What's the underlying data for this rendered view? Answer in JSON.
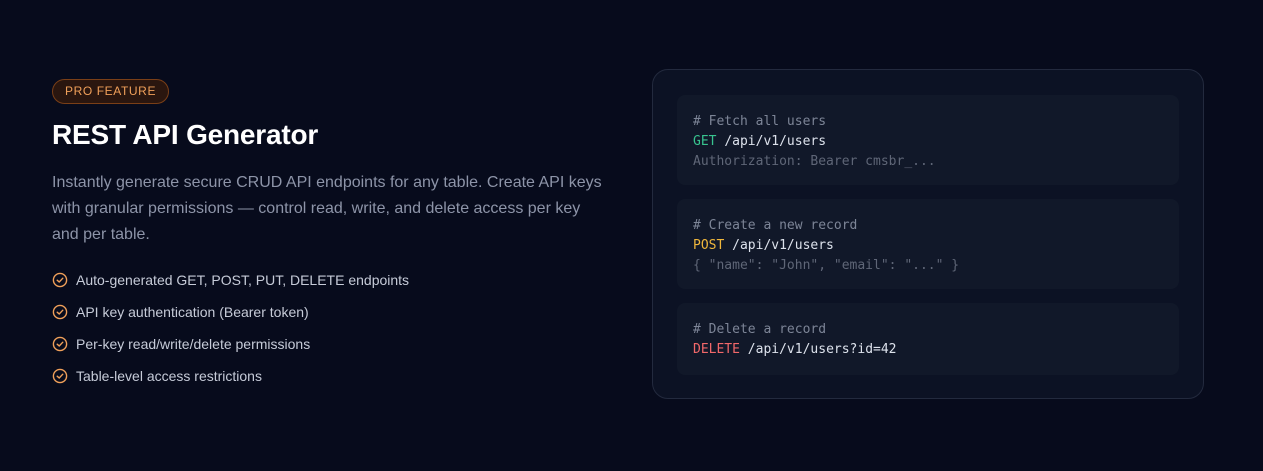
{
  "badge": "PRO FEATURE",
  "title": "REST API Generator",
  "description": "Instantly generate secure CRUD API endpoints for any table. Create API keys with granular permissions — control read, write, and delete access per key and per table.",
  "features": [
    "Auto-generated GET, POST, PUT, DELETE endpoints",
    "API key authentication (Bearer token)",
    "Per-key read/write/delete permissions",
    "Table-level access restrictions"
  ],
  "feature_icon": "check-circle-icon",
  "colors": {
    "background": "#070b1c",
    "accent": "#f0a05a",
    "get": "#38c38f",
    "post": "#f0b73c",
    "delete": "#f2686a"
  },
  "code_blocks": [
    {
      "comment": "# Fetch all users",
      "method": "GET",
      "path": "/api/v1/users",
      "extra": "Authorization: Bearer cmsbr_..."
    },
    {
      "comment": "# Create a new record",
      "method": "POST",
      "path": "/api/v1/users",
      "extra": "{ \"name\": \"John\", \"email\": \"...\" }"
    },
    {
      "comment": "# Delete a record",
      "method": "DELETE",
      "path": "/api/v1/users?id=42"
    }
  ]
}
